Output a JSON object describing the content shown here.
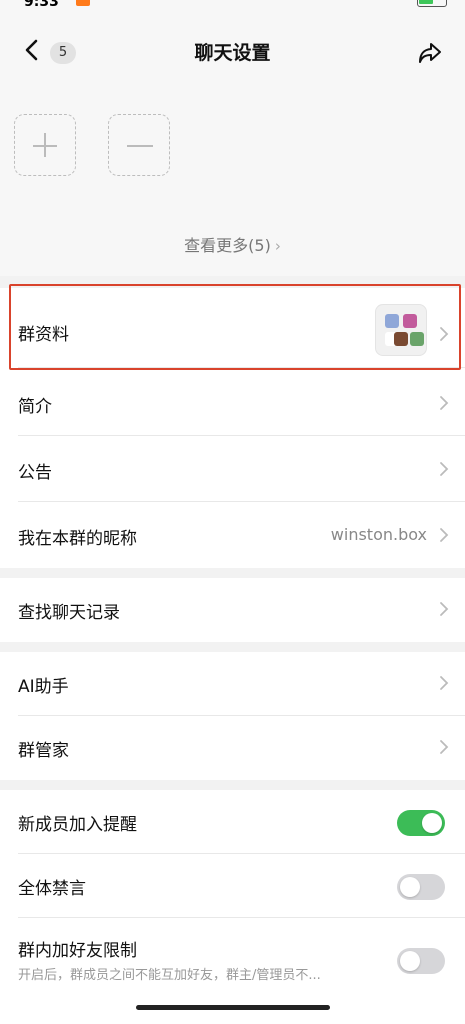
{
  "status_bar": {
    "time": "9:33",
    "indicators": "ull ⌒"
  },
  "nav": {
    "back_icon": "chevron-left-icon",
    "badge": "5",
    "title": "聊天设置",
    "share_icon": "share-icon"
  },
  "members": {
    "add_icon": "plus-icon",
    "remove_icon": "minus-icon",
    "see_more": "查看更多(5)"
  },
  "rows": {
    "group_info": "群资料",
    "intro": "简介",
    "announcement": "公告",
    "my_nickname": "我在本群的昵称",
    "my_nickname_value": "winston.box",
    "search_history": "查找聊天记录",
    "ai_assistant": "AI助手",
    "group_manager": "群管家",
    "new_member_alert": "新成员加入提醒",
    "mute_all": "全体禁言",
    "friend_limit": "群内加好友限制",
    "friend_limit_desc": "开启后，群成员之间不能互加好友，群主/管理员不..."
  },
  "toggles": {
    "new_member_alert": true,
    "mute_all": false,
    "friend_limit": false
  },
  "colors": {
    "accent_green": "#3cbc57",
    "highlight_red": "#d9432c",
    "background": "#f2f2f2"
  }
}
